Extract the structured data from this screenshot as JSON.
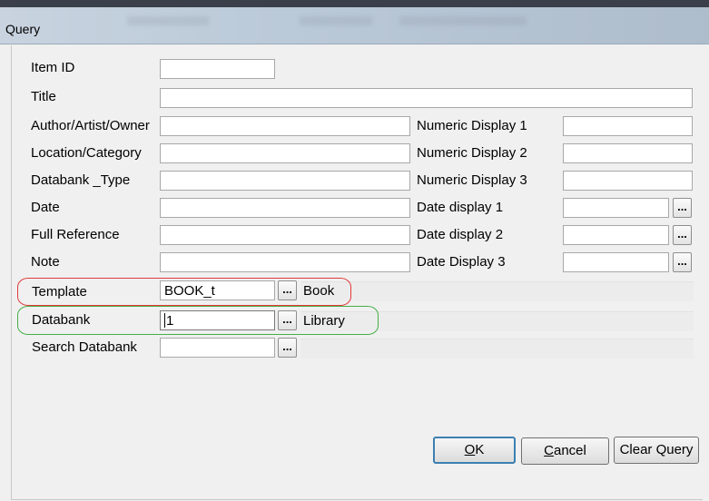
{
  "window": {
    "title": "Query"
  },
  "fields": {
    "item_id": {
      "label": "Item ID",
      "value": ""
    },
    "title": {
      "label": "Title",
      "value": ""
    },
    "author": {
      "label": "Author/Artist/Owner",
      "value": ""
    },
    "location": {
      "label": "Location/Category",
      "value": ""
    },
    "databank_type": {
      "label": "Databank _Type",
      "value": ""
    },
    "date": {
      "label": "Date",
      "value": ""
    },
    "full_reference": {
      "label": "Full Reference",
      "value": ""
    },
    "note": {
      "label": "Note",
      "value": ""
    },
    "numeric_display_1": {
      "label": "Numeric Display 1",
      "value": ""
    },
    "numeric_display_2": {
      "label": "Numeric Display 2",
      "value": ""
    },
    "numeric_display_3": {
      "label": "Numeric Display 3",
      "value": ""
    },
    "date_display_1": {
      "label": "Date display 1",
      "value": ""
    },
    "date_display_2": {
      "label": "Date display 2",
      "value": ""
    },
    "date_display_3": {
      "label": "Date Display 3",
      "value": ""
    },
    "template": {
      "label": "Template",
      "value": "BOOK_t",
      "description": "Book"
    },
    "databank": {
      "label": "Databank",
      "value": "1",
      "description": "Library"
    },
    "search_databank": {
      "label": "Search Databank",
      "value": "",
      "description": ""
    }
  },
  "lookup_button_label": "...",
  "buttons": {
    "ok": {
      "accel": "O",
      "rest": "K"
    },
    "cancel": {
      "accel": "C",
      "rest": "ancel"
    },
    "clear_query": {
      "label": "Clear Query"
    }
  },
  "annotations": {
    "template_outline_color": "#e23a3a",
    "databank_outline_color": "#45b045"
  }
}
